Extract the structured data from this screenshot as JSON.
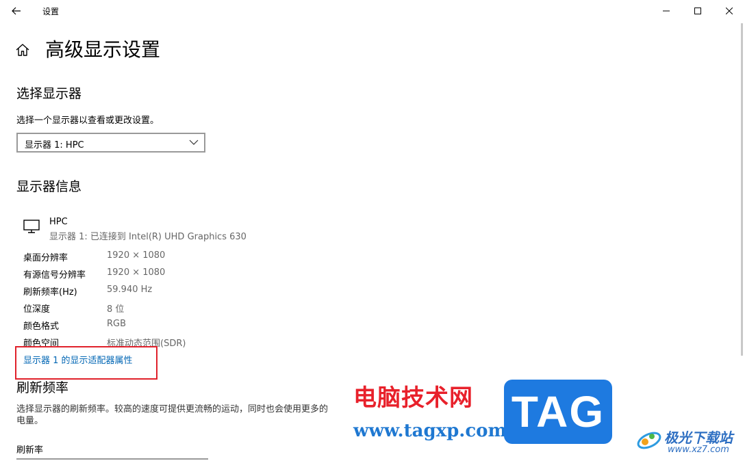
{
  "window": {
    "title": "设置"
  },
  "page": {
    "title": "高级显示设置"
  },
  "select_display": {
    "heading": "选择显示器",
    "description": "选择一个显示器以查看或更改设置。",
    "dropdown_value": "显示器 1: HPC"
  },
  "display_info": {
    "heading": "显示器信息",
    "name": "HPC",
    "connection": "显示器 1: 已连接到 Intel(R) UHD Graphics 630",
    "rows": [
      {
        "label": "桌面分辨率",
        "value": "1920 × 1080"
      },
      {
        "label": "有源信号分辨率",
        "value": "1920 × 1080"
      },
      {
        "label": "刷新频率(Hz)",
        "value": "59.940 Hz"
      },
      {
        "label": "位深度",
        "value": "8 位"
      },
      {
        "label": "颜色格式",
        "value": "RGB"
      },
      {
        "label": "颜色空间",
        "value": "标准动态范围(SDR)"
      }
    ],
    "adapter_link": "显示器 1 的显示适配器属性"
  },
  "refresh": {
    "heading": "刷新频率",
    "description": "选择显示器的刷新频率。较高的速度可提供更流畅的运动，同时也会使用更多的电量。",
    "rate_label": "刷新率"
  },
  "watermark": {
    "cn_text": "电脑技术网",
    "url": "www.tagxp.com",
    "tag_text": "TAG",
    "xz_title": "极光下载站",
    "xz_url": "www.xz7.com"
  },
  "colors": {
    "link": "#0066b4",
    "highlight": "#e0202a",
    "secondary_text": "#666666"
  }
}
